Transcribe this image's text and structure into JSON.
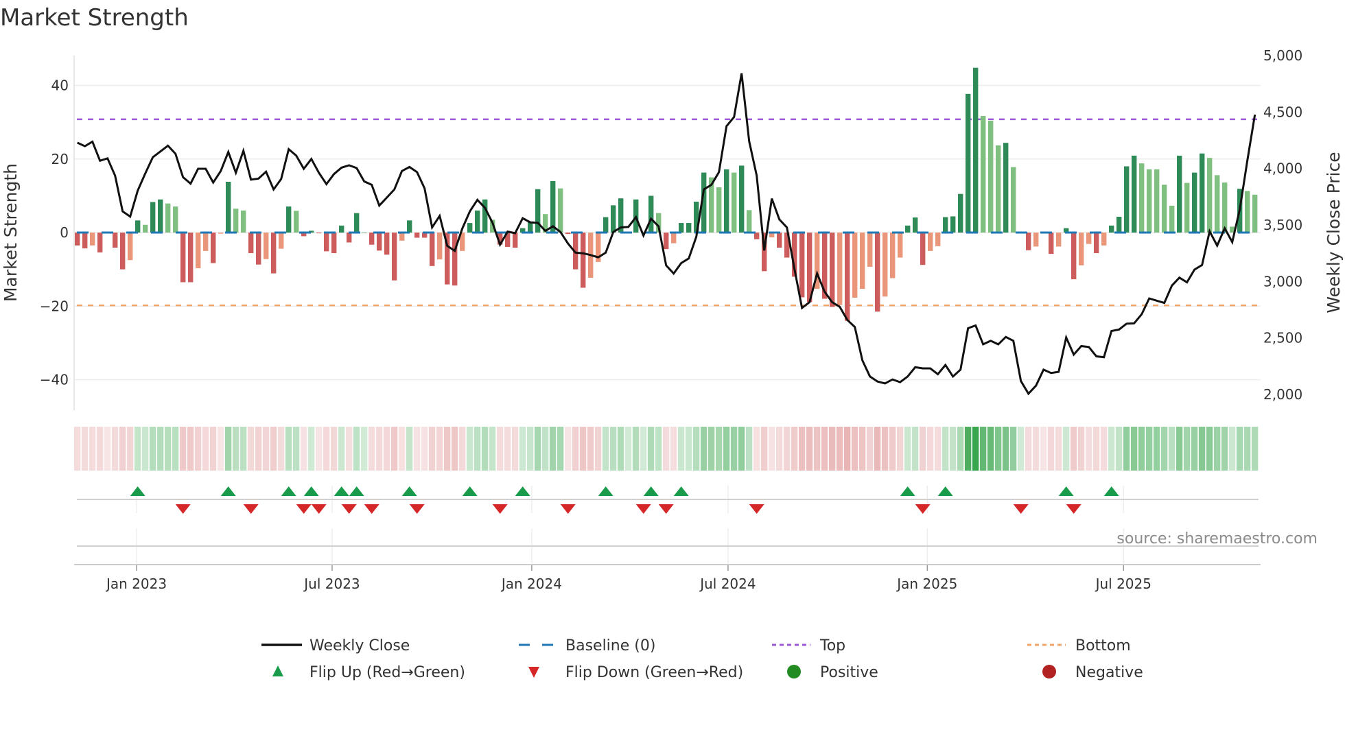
{
  "chart_data": {
    "type": "bar+line",
    "title": "Market Strength",
    "ylabel_left": "Market Strength",
    "ylabel_right": "Weekly Close Price",
    "source": "source: sharemaestro.com",
    "ylim_left": [
      -48,
      48
    ],
    "ylim_right": [
      1900,
      5100
    ],
    "left_ticks": [
      {
        "value": 40,
        "label": "40"
      },
      {
        "value": 20,
        "label": "20"
      },
      {
        "value": 0,
        "label": "0"
      },
      {
        "value": -20,
        "label": "−20"
      },
      {
        "value": -40,
        "label": "−40"
      }
    ],
    "right_ticks": [
      {
        "value": 5000,
        "label": "5,000"
      },
      {
        "value": 4500,
        "label": "4,500"
      },
      {
        "value": 4000,
        "label": "4,000"
      },
      {
        "value": 3500,
        "label": "3,500"
      },
      {
        "value": 3000,
        "label": "3,000"
      },
      {
        "value": 2500,
        "label": "2,500"
      },
      {
        "value": 2000,
        "label": "2,000"
      }
    ],
    "x_ticks": [
      {
        "week": 7.85,
        "label": "Jan 2023"
      },
      {
        "week": 33.75,
        "label": "Jul 2023"
      },
      {
        "week": 60.2,
        "label": "Jan 2024"
      },
      {
        "week": 86.2,
        "label": "Jul 2024"
      },
      {
        "week": 112.6,
        "label": "Jan 2025"
      },
      {
        "week": 138.6,
        "label": "Jul 2025"
      }
    ],
    "grid": true,
    "top_level": 30.8,
    "bottom_level": -19.8,
    "baseline": 0,
    "strength": [
      -3.5,
      -4.3,
      -3.5,
      -5.4,
      0,
      -4.1,
      -10,
      -7.5,
      3.3,
      2.1,
      8.3,
      9,
      7.9,
      7.1,
      -13.5,
      -13.5,
      -9.7,
      -5,
      -8.3,
      -0.3,
      13.8,
      6.5,
      6,
      -5.6,
      -8.7,
      -7.2,
      -11.1,
      -4.4,
      7.1,
      5.9,
      -1,
      0.5,
      -0.2,
      -5.1,
      -5.6,
      1.9,
      -2.7,
      5.3,
      0,
      -3.3,
      -4.9,
      -6,
      -13,
      -2.2,
      3.3,
      -1.4,
      -1.4,
      -9.1,
      -7.3,
      -14.1,
      -14.4,
      -5,
      2.6,
      6,
      9,
      3.5,
      -3.3,
      -3.9,
      -4.1,
      1.2,
      3,
      11.8,
      5,
      14,
      12,
      -0.4,
      -10,
      -15,
      -12.3,
      -8,
      4.2,
      7.4,
      9.3,
      0,
      9,
      0,
      10,
      5.3,
      -4.5,
      -2.9,
      2.6,
      2.6,
      8.4,
      16.3,
      15,
      12.3,
      17.2,
      16.3,
      18.2,
      6.1,
      -1.8,
      -10.5,
      -1.3,
      -4.1,
      -6.8,
      -12,
      -17.6,
      -18.9,
      -15.3,
      -18,
      -20.2,
      -19.7,
      -24,
      -17.7,
      -15.3,
      -9.3,
      -21.5,
      -17.4,
      -12.4,
      -6.8,
      1.9,
      4.1,
      -8.8,
      -5,
      -3.7,
      4.2,
      4.4,
      10.5,
      37.7,
      44.8,
      31.7,
      30.4,
      23.7,
      24.4,
      17.8,
      0,
      -4.8,
      -3.8,
      0,
      -5.8,
      -3.8,
      1.2,
      -12.7,
      -8.9,
      -3.1,
      -5.6,
      -3.5,
      1.9,
      4.3,
      18,
      20.9,
      18.8,
      17.2,
      17.2,
      13,
      7.3,
      20.9,
      13.5,
      16.3,
      21.5,
      20.3,
      15.6,
      13.6,
      1.6,
      11.9,
      11.3,
      10.3
    ],
    "weekly_close": [
      4229,
      4198,
      4238,
      4069,
      4090,
      3937,
      3621,
      3575,
      3805,
      3957,
      4100,
      4151,
      4202,
      4131,
      3923,
      3866,
      3998,
      3998,
      3876,
      3978,
      4147,
      3963,
      4157,
      3902,
      3911,
      3972,
      3815,
      3907,
      4171,
      4114,
      3998,
      4085,
      3963,
      3862,
      3951,
      4008,
      4029,
      4004,
      3886,
      3856,
      3672,
      3743,
      3815,
      3978,
      4014,
      3968,
      3825,
      3479,
      3581,
      3316,
      3271,
      3469,
      3621,
      3723,
      3652,
      3520,
      3326,
      3442,
      3428,
      3560,
      3524,
      3520,
      3448,
      3489,
      3438,
      3336,
      3255,
      3250,
      3234,
      3214,
      3255,
      3438,
      3479,
      3483,
      3570,
      3407,
      3556,
      3489,
      3143,
      3070,
      3163,
      3204,
      3397,
      3815,
      3856,
      3968,
      4375,
      4456,
      4843,
      4243,
      3937,
      3275,
      3734,
      3550,
      3479,
      3112,
      2766,
      2817,
      3071,
      2909,
      2817,
      2776,
      2660,
      2597,
      2302,
      2159,
      2115,
      2098,
      2133,
      2109,
      2159,
      2241,
      2231,
      2231,
      2180,
      2261,
      2159,
      2220,
      2586,
      2611,
      2444,
      2475,
      2444,
      2509,
      2475,
      2119,
      2007,
      2078,
      2220,
      2190,
      2200,
      2505,
      2353,
      2428,
      2420,
      2338,
      2330,
      2562,
      2575,
      2627,
      2630,
      2710,
      2850,
      2830,
      2810,
      2963,
      3034,
      2993,
      3105,
      3146,
      3444,
      3318,
      3471,
      3349,
      3640,
      4071,
      4477
    ],
    "flip_up_weeks": [
      8,
      20,
      28,
      31,
      35,
      37,
      44,
      52,
      59,
      70,
      76,
      80,
      110,
      115,
      131,
      137
    ],
    "flip_down_weeks": [
      14,
      23,
      30,
      32,
      36,
      39,
      45,
      56,
      65,
      75,
      78,
      90,
      112,
      125,
      132
    ],
    "legend": [
      {
        "label": "Weekly Close",
        "symbol": "solid-line",
        "color": "#111111"
      },
      {
        "label": "Baseline (0)",
        "symbol": "dashed-line",
        "color": "#1f77b4"
      },
      {
        "label": "Top",
        "symbol": "dotted-line",
        "color": "#9b59d6"
      },
      {
        "label": "Bottom",
        "symbol": "dotted-line",
        "color": "#f0a46a"
      },
      {
        "label": "Flip Up (Red→Green)",
        "symbol": "triangle-up",
        "color": "#1a9b4b"
      },
      {
        "label": "Flip Down (Green→Red)",
        "symbol": "triangle-down",
        "color": "#d62728"
      },
      {
        "label": "Positive",
        "symbol": "circle",
        "color": "#228b22"
      },
      {
        "label": "Negative",
        "symbol": "circle",
        "color": "#b22222"
      }
    ],
    "colors": {
      "bar_pos_strong": "#2e8b57",
      "bar_pos_weak": "#7fbf7f",
      "bar_neg_strong": "#cd5c5c",
      "bar_neg_weak": "#e9967a",
      "line": "#111111",
      "top": "#9b59d6",
      "bottom": "#f0a46a",
      "baseline": "#1f77b4",
      "flip_up": "#1a9b4b",
      "flip_down": "#d62728"
    }
  }
}
